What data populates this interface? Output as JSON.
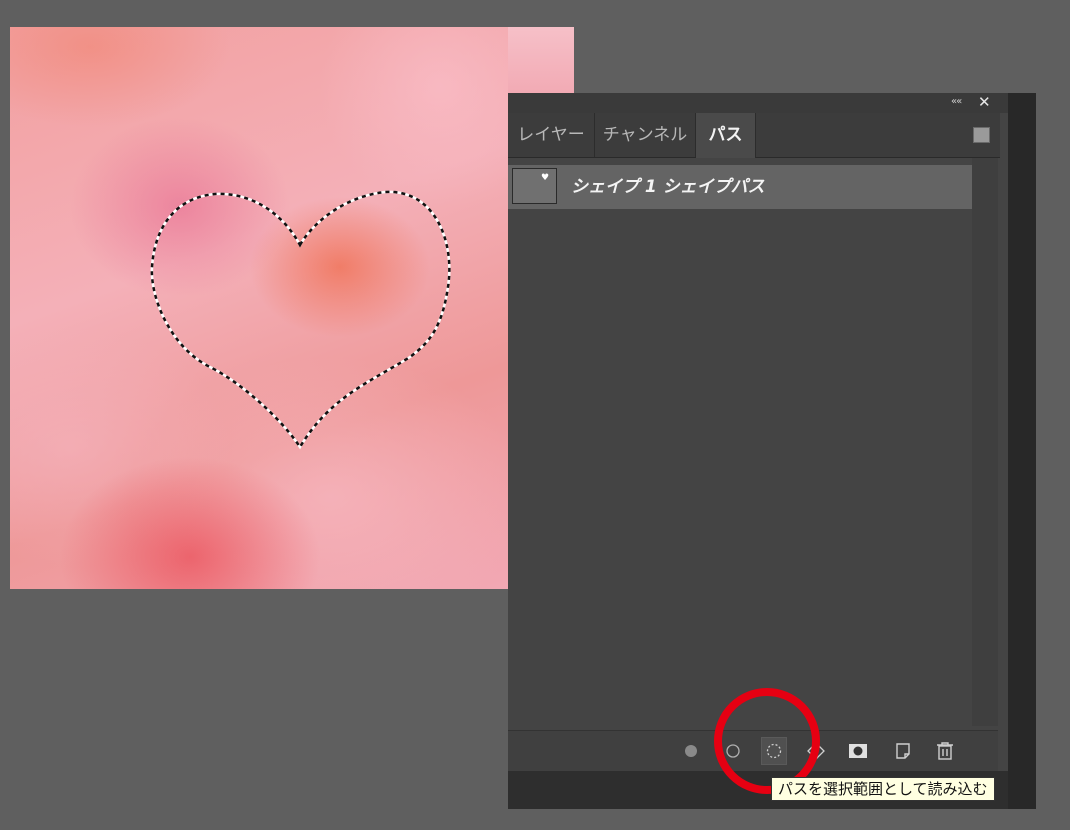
{
  "panel": {
    "tabs": [
      {
        "label": "レイヤー",
        "active": false
      },
      {
        "label": "チャンネル",
        "active": false
      },
      {
        "label": "パス",
        "active": true
      }
    ],
    "header_icons": {
      "collapse": "««",
      "close": "✕"
    }
  },
  "paths": [
    {
      "name": "シェイプ 1 シェイプパス",
      "selected": true
    }
  ],
  "toolbar": {
    "buttons": [
      {
        "icon": "fill-path-icon"
      },
      {
        "icon": "stroke-path-icon"
      },
      {
        "icon": "load-path-as-selection-icon"
      },
      {
        "icon": "make-work-path-icon"
      },
      {
        "icon": "add-mask-icon"
      },
      {
        "icon": "new-path-icon"
      },
      {
        "icon": "delete-path-icon"
      }
    ]
  },
  "tooltip": {
    "text": "パスを選択範囲として読み込む"
  },
  "colors": {
    "highlight_circle": "#e60012",
    "panel_bg": "#444444",
    "tooltip_bg": "#ffffe1"
  }
}
